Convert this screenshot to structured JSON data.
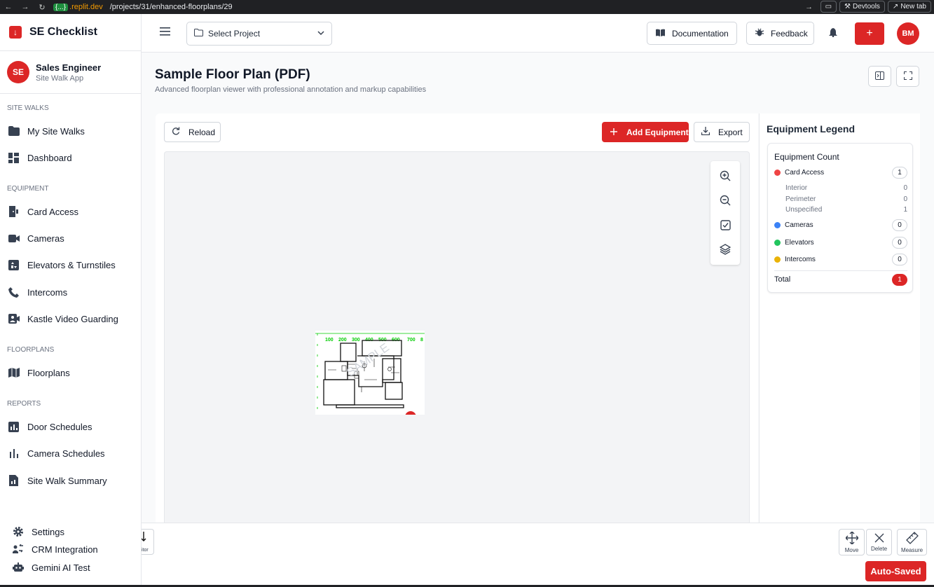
{
  "browser": {
    "host_braces": "{...}",
    "host": ".replit.dev",
    "path": "/projects/31/enhanced-floorplans/29",
    "devtools": "Devtools",
    "new_tab": "New tab"
  },
  "sidebar": {
    "brand": "SE Checklist",
    "user": {
      "initials": "SE",
      "name": "Sales Engineer",
      "subtitle": "Site Walk App"
    },
    "sections": {
      "site_walks": "SITE WALKS",
      "equipment": "EQUIPMENT",
      "floorplans": "FLOORPLANS",
      "reports": "REPORTS"
    },
    "items": {
      "my_site_walks": "My Site Walks",
      "dashboard": "Dashboard",
      "card_access": "Card Access",
      "cameras": "Cameras",
      "elevators": "Elevators & Turnstiles",
      "intercoms": "Intercoms",
      "kastle": "Kastle Video Guarding",
      "floorplans": "Floorplans",
      "door_schedules": "Door Schedules",
      "camera_schedules": "Camera Schedules",
      "site_walk_summary": "Site Walk Summary"
    },
    "bottom": {
      "settings": "Settings",
      "crm": "CRM Integration",
      "gemini": "Gemini AI Test"
    }
  },
  "header": {
    "select_project": "Select Project",
    "documentation": "Documentation",
    "feedback": "Feedback",
    "plus": "+",
    "avatar": "BM"
  },
  "page": {
    "title": "Sample Floor Plan (PDF)",
    "subtitle": "Advanced floorplan viewer with professional annotation and markup capabilities"
  },
  "viewer": {
    "reload": "Reload",
    "add_equipment": "Add Equipment",
    "export": "Export",
    "ruler_labels": [
      "100",
      "200",
      "300",
      "400",
      "500",
      "600",
      "700",
      "8"
    ]
  },
  "legend": {
    "title": "Equipment Legend",
    "card_title": "Equipment Count",
    "card_access": {
      "label": "Card Access",
      "count": "1",
      "color": "#ef4444"
    },
    "sub": [
      {
        "label": "Interior",
        "value": "0"
      },
      {
        "label": "Perimeter",
        "value": "0"
      },
      {
        "label": "Unspecified",
        "value": "1"
      }
    ],
    "cameras": {
      "label": "Cameras",
      "count": "0",
      "color": "#3b82f6"
    },
    "elevators": {
      "label": "Elevators",
      "count": "0",
      "color": "#22c55e"
    },
    "intercoms": {
      "label": "Intercoms",
      "count": "0",
      "color": "#eab308"
    },
    "total": {
      "label": "Total",
      "count": "1"
    }
  },
  "toolbar": {
    "left_tool": "itor",
    "move": "Move",
    "delete": "Delete",
    "measure": "Measure",
    "autosaved": "Auto-Saved"
  },
  "colors": {
    "accent": "#dc2626",
    "ruler": "#00cc00"
  }
}
